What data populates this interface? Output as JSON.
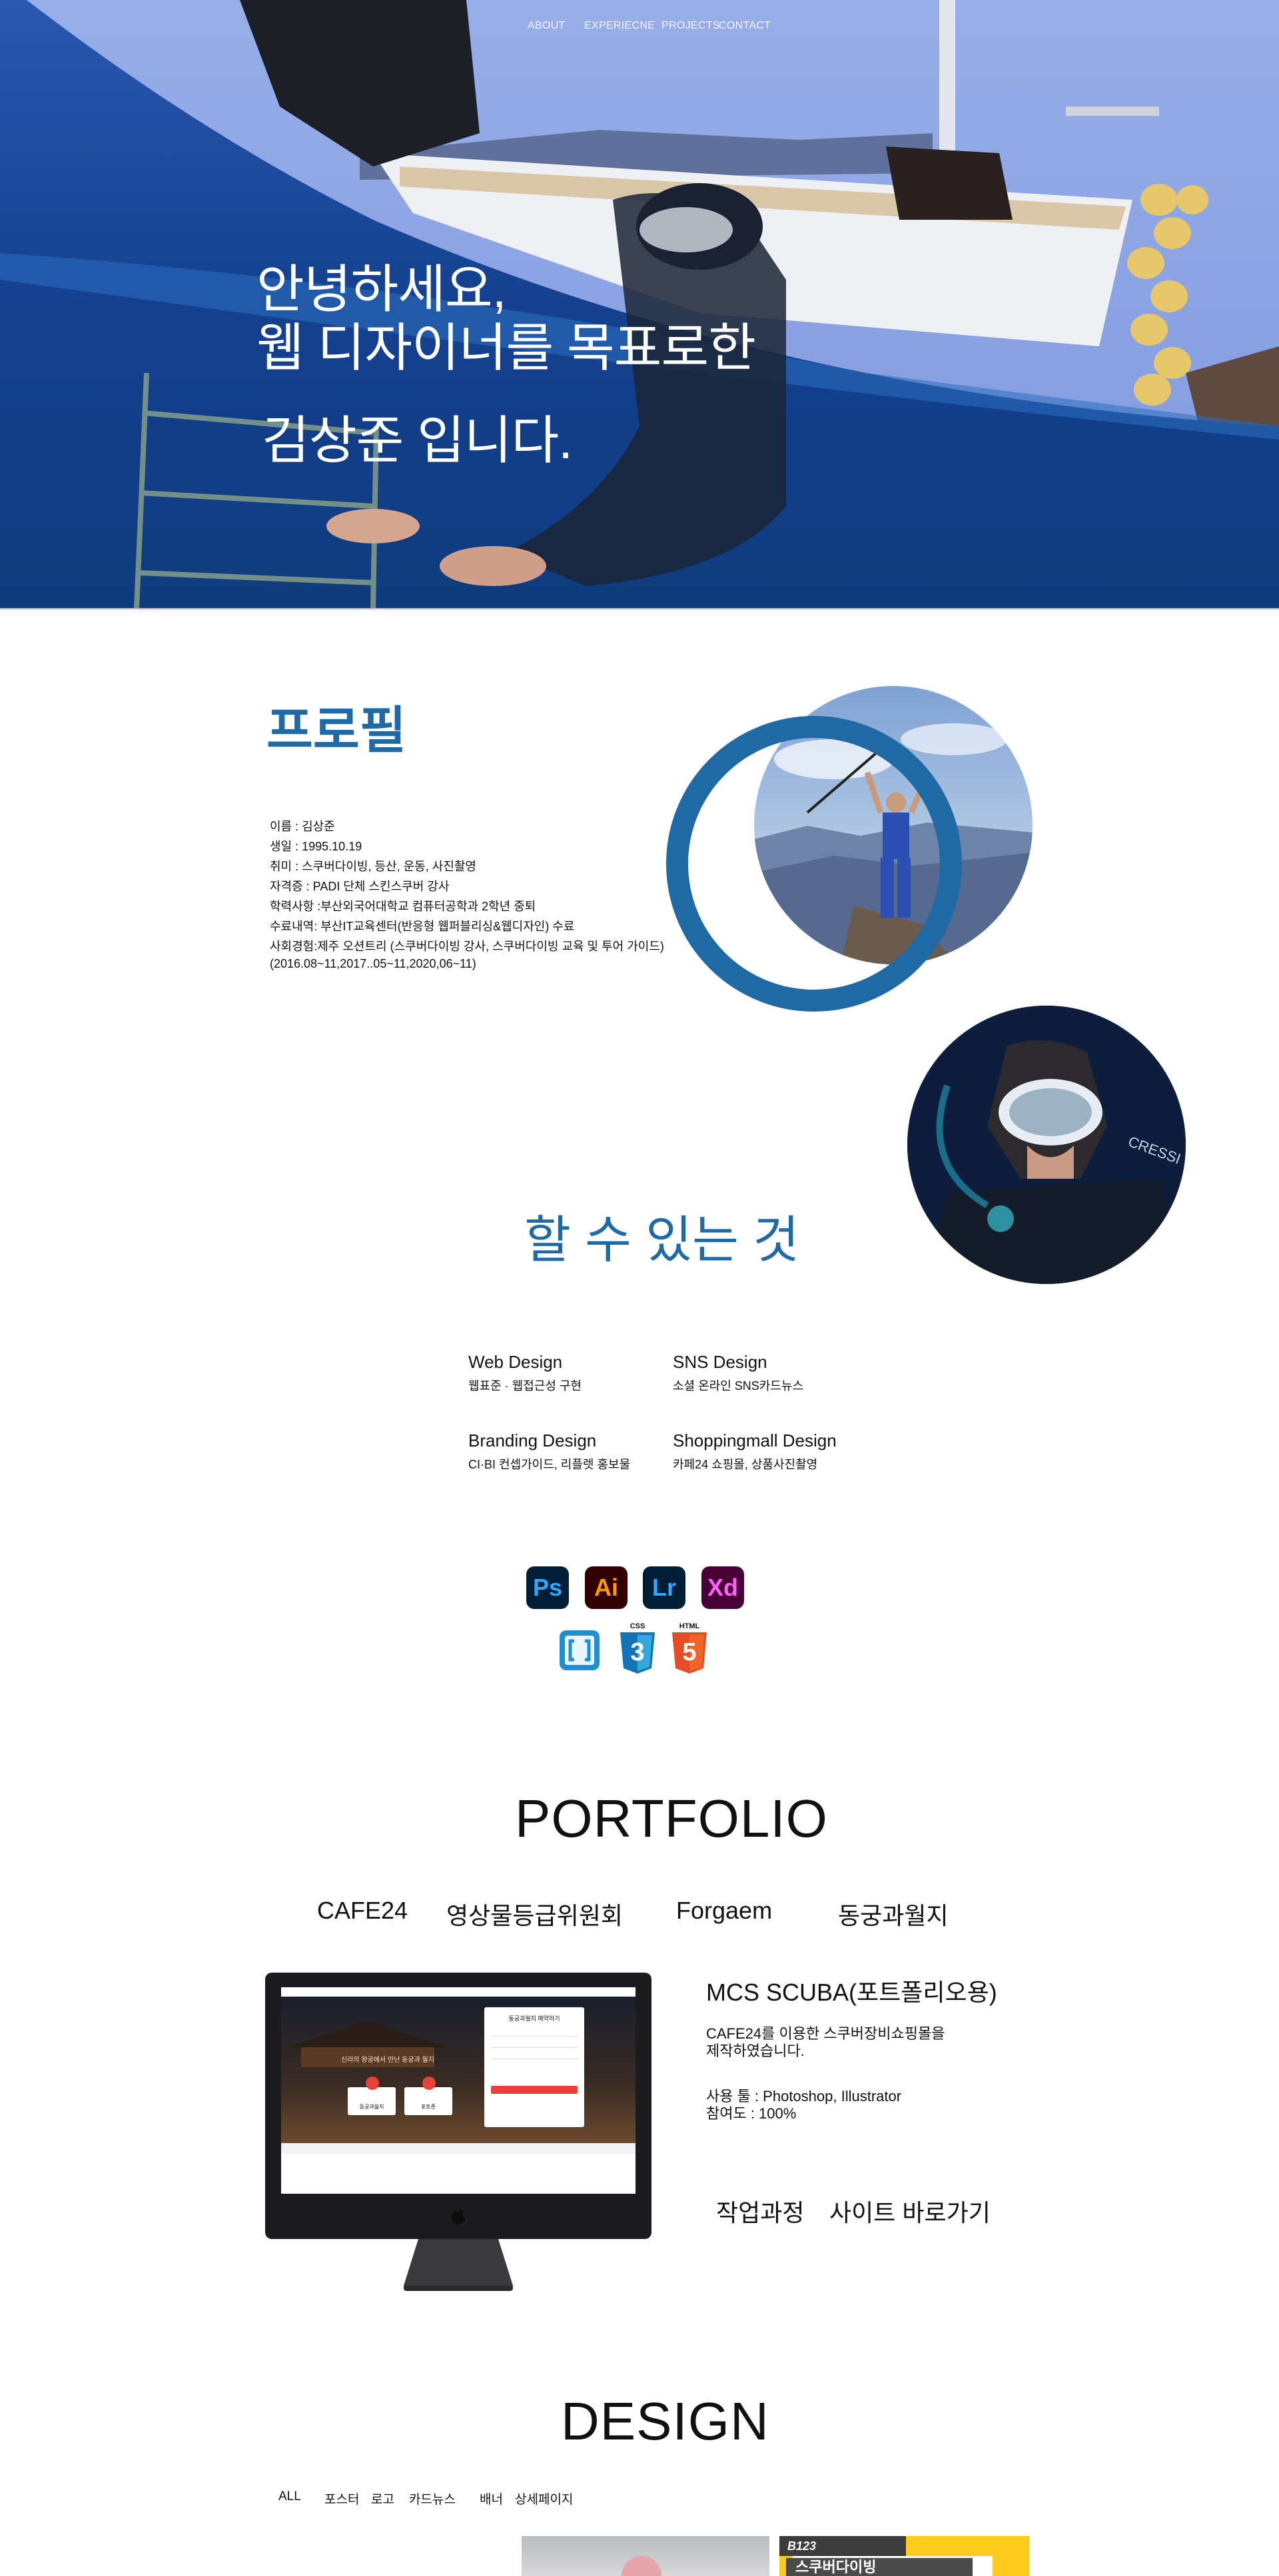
{
  "nav": {
    "about": "ABOUT",
    "experience": "EXPERIECNE",
    "projects": "PROJECTS",
    "contact": "CONTACT"
  },
  "hero": {
    "line1": "안녕하세요,",
    "line2": "웹 디자이너를 목표로한",
    "line3": "김상준 입니다."
  },
  "profile": {
    "title": "프로필",
    "lines": [
      "이름 : 김상준",
      "생일 : 1995.10.19",
      "취미 : 스쿠버다이빙, 등산, 운동, 사진촬영",
      "자격증 : PADI 단체 스킨스쿠버 강사",
      "학력사항 :부산외국어대학교 컴퓨터공학과 2학년 중퇴",
      "수료내역: 부산IT교육센터(반응형 웹퍼블리싱&웹디자인) 수료",
      "사회경험:제주 오션트리 (스쿠버다이빙 강사, 스쿠버다이빙 교육 및 투어 가이드)",
      "(2016.08~11,2017..05~11,2020,06~11)"
    ]
  },
  "skills": {
    "title": "할 수 있는 것",
    "items": [
      {
        "title": "Web Design",
        "desc": "웹표준 · 웹접근성 구현"
      },
      {
        "title": "SNS Design",
        "desc": "소셜 온라인 SNS카드뉴스"
      },
      {
        "title": "Branding Design",
        "desc": "CI·BI 컨셉가이드, 리플렛 홍보물"
      },
      {
        "title": "Shoppingmall Design",
        "desc": "카페24 쇼핑몰, 상품사진촬영"
      }
    ],
    "tools": {
      "ps": "Ps",
      "ai": "Ai",
      "lr": "Lr",
      "xd": "Xd",
      "css_label": "CSS",
      "html_label": "HTML",
      "css_num": "3",
      "html_num": "5"
    }
  },
  "portfolio": {
    "title": "PORTFOLIO",
    "tabs": [
      "CAFE24",
      "영상물등급위원회",
      "Forgaem",
      "동궁과월지"
    ],
    "project_title": "MCS SCUBA(포트폴리오용)",
    "desc_line1": "CAFE24를 이용한 스쿠버장비쇼핑몰을",
    "desc_line2": "제작하였습니다.",
    "tools_line": "사용 툴 : Photoshop, Illustrator",
    "share_line": "참여도 : 100%",
    "process_btn": "작업과정",
    "site_btn": "사이트 바로가기",
    "mock": {
      "form_title": "동궁과월지 예약하기",
      "hero_small": "신라의 왕궁에서 만난 동궁과 월지",
      "card1": "동궁과월지",
      "card2": "포토존"
    }
  },
  "design": {
    "title": "DESIGN",
    "tabs": [
      "ALL",
      "포스터",
      "로고",
      "카드뉴스",
      "배너",
      "상세페이지"
    ],
    "thumb_tag": "B123",
    "thumb_text": "스쿠버다이빙"
  },
  "colors": {
    "accent": "#1f6aa5",
    "hero_blue": "#173b86"
  }
}
